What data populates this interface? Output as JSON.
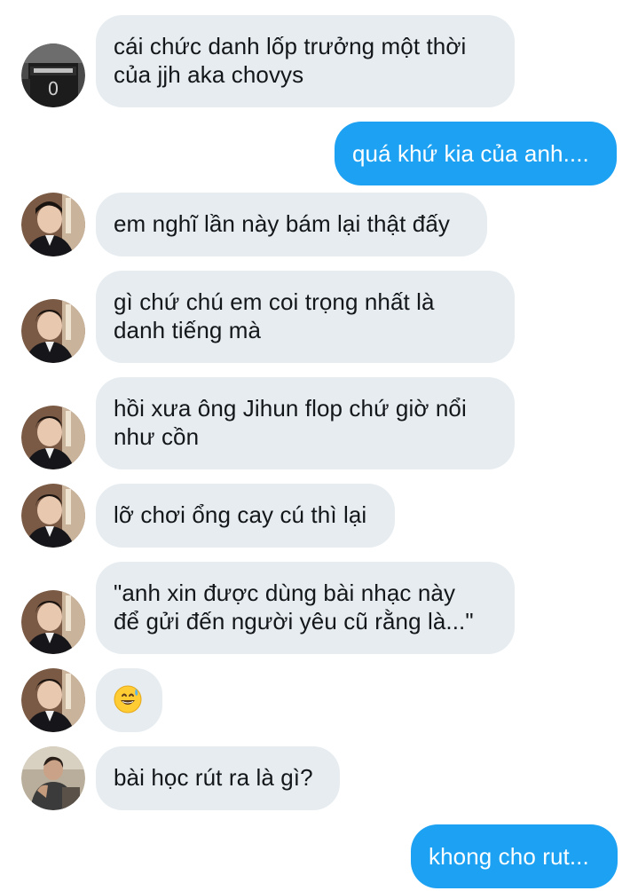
{
  "conversation": {
    "messages": [
      {
        "direction": "incoming",
        "avatar": "jersey-photo-avatar",
        "lines": [
          "cái chức danh lốp trưởng một thời",
          "của jjh aka chovys"
        ]
      },
      {
        "direction": "outgoing",
        "lines": [
          "quá khứ kia của anh...."
        ]
      },
      {
        "direction": "incoming",
        "avatar": "suit-portrait-avatar",
        "lines": [
          "em nghĩ lần này bám lại thật đấy"
        ]
      },
      {
        "direction": "incoming",
        "avatar": "suit-portrait-avatar",
        "lines": [
          "gì chứ chú em coi trọng nhất là",
          "danh tiếng mà"
        ]
      },
      {
        "direction": "incoming",
        "avatar": "suit-portrait-avatar",
        "lines": [
          "hồi xưa ông Jihun flop chứ giờ nổi",
          "như cồn"
        ]
      },
      {
        "direction": "incoming",
        "avatar": "suit-portrait-avatar",
        "lines": [
          "lỡ chơi ổng cay cú thì lại"
        ]
      },
      {
        "direction": "incoming",
        "avatar": "suit-portrait-avatar",
        "lines": [
          "\"anh xin được dùng bài nhạc này",
          "để gửi đến người yêu cũ rằng là...\""
        ]
      },
      {
        "direction": "incoming",
        "avatar": "suit-portrait-avatar",
        "emoji": "grinning-face-with-sweat-emoji"
      },
      {
        "direction": "incoming",
        "avatar": "street-photo-avatar",
        "lines": [
          "bài học rút ra là gì?"
        ]
      },
      {
        "direction": "outgoing",
        "lines": [
          "khong cho rut..."
        ]
      }
    ]
  },
  "colors": {
    "incoming_bubble": "#e6ecf0",
    "incoming_text": "#14171a",
    "outgoing_bubble": "#1da1f2",
    "outgoing_text": "#ffffff"
  }
}
